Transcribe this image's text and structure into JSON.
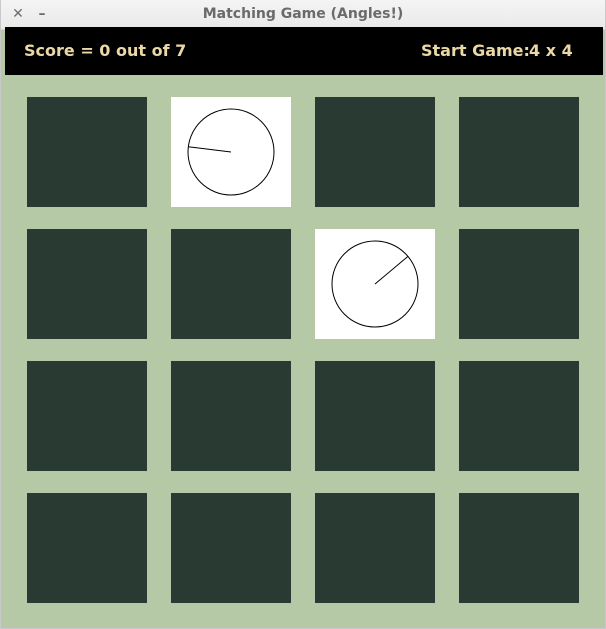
{
  "window": {
    "title": "Matching Game (Angles!)",
    "close_glyph": "✕",
    "minimize_glyph": "–"
  },
  "header": {
    "score_text": "Score = 0 out of 7",
    "start_label": "Start Game:",
    "grid_size": "4 x 4"
  },
  "colors": {
    "background": "#b5c9a6",
    "card_back": "#293a33",
    "card_face": "#ffffff",
    "header_bg": "#000000",
    "header_text": "#ead8a6"
  },
  "board": {
    "rows": 4,
    "cols": 4,
    "cards": [
      {
        "row": 0,
        "col": 0,
        "state": "hidden"
      },
      {
        "row": 0,
        "col": 1,
        "state": "revealed",
        "angle_deg": 173
      },
      {
        "row": 0,
        "col": 2,
        "state": "hidden"
      },
      {
        "row": 0,
        "col": 3,
        "state": "hidden"
      },
      {
        "row": 1,
        "col": 0,
        "state": "hidden"
      },
      {
        "row": 1,
        "col": 1,
        "state": "hidden"
      },
      {
        "row": 1,
        "col": 2,
        "state": "revealed",
        "angle_deg": 40
      },
      {
        "row": 1,
        "col": 3,
        "state": "hidden"
      },
      {
        "row": 2,
        "col": 0,
        "state": "hidden"
      },
      {
        "row": 2,
        "col": 1,
        "state": "hidden"
      },
      {
        "row": 2,
        "col": 2,
        "state": "hidden"
      },
      {
        "row": 2,
        "col": 3,
        "state": "hidden"
      },
      {
        "row": 3,
        "col": 0,
        "state": "hidden"
      },
      {
        "row": 3,
        "col": 1,
        "state": "hidden"
      },
      {
        "row": 3,
        "col": 2,
        "state": "hidden"
      },
      {
        "row": 3,
        "col": 3,
        "state": "hidden"
      }
    ]
  }
}
